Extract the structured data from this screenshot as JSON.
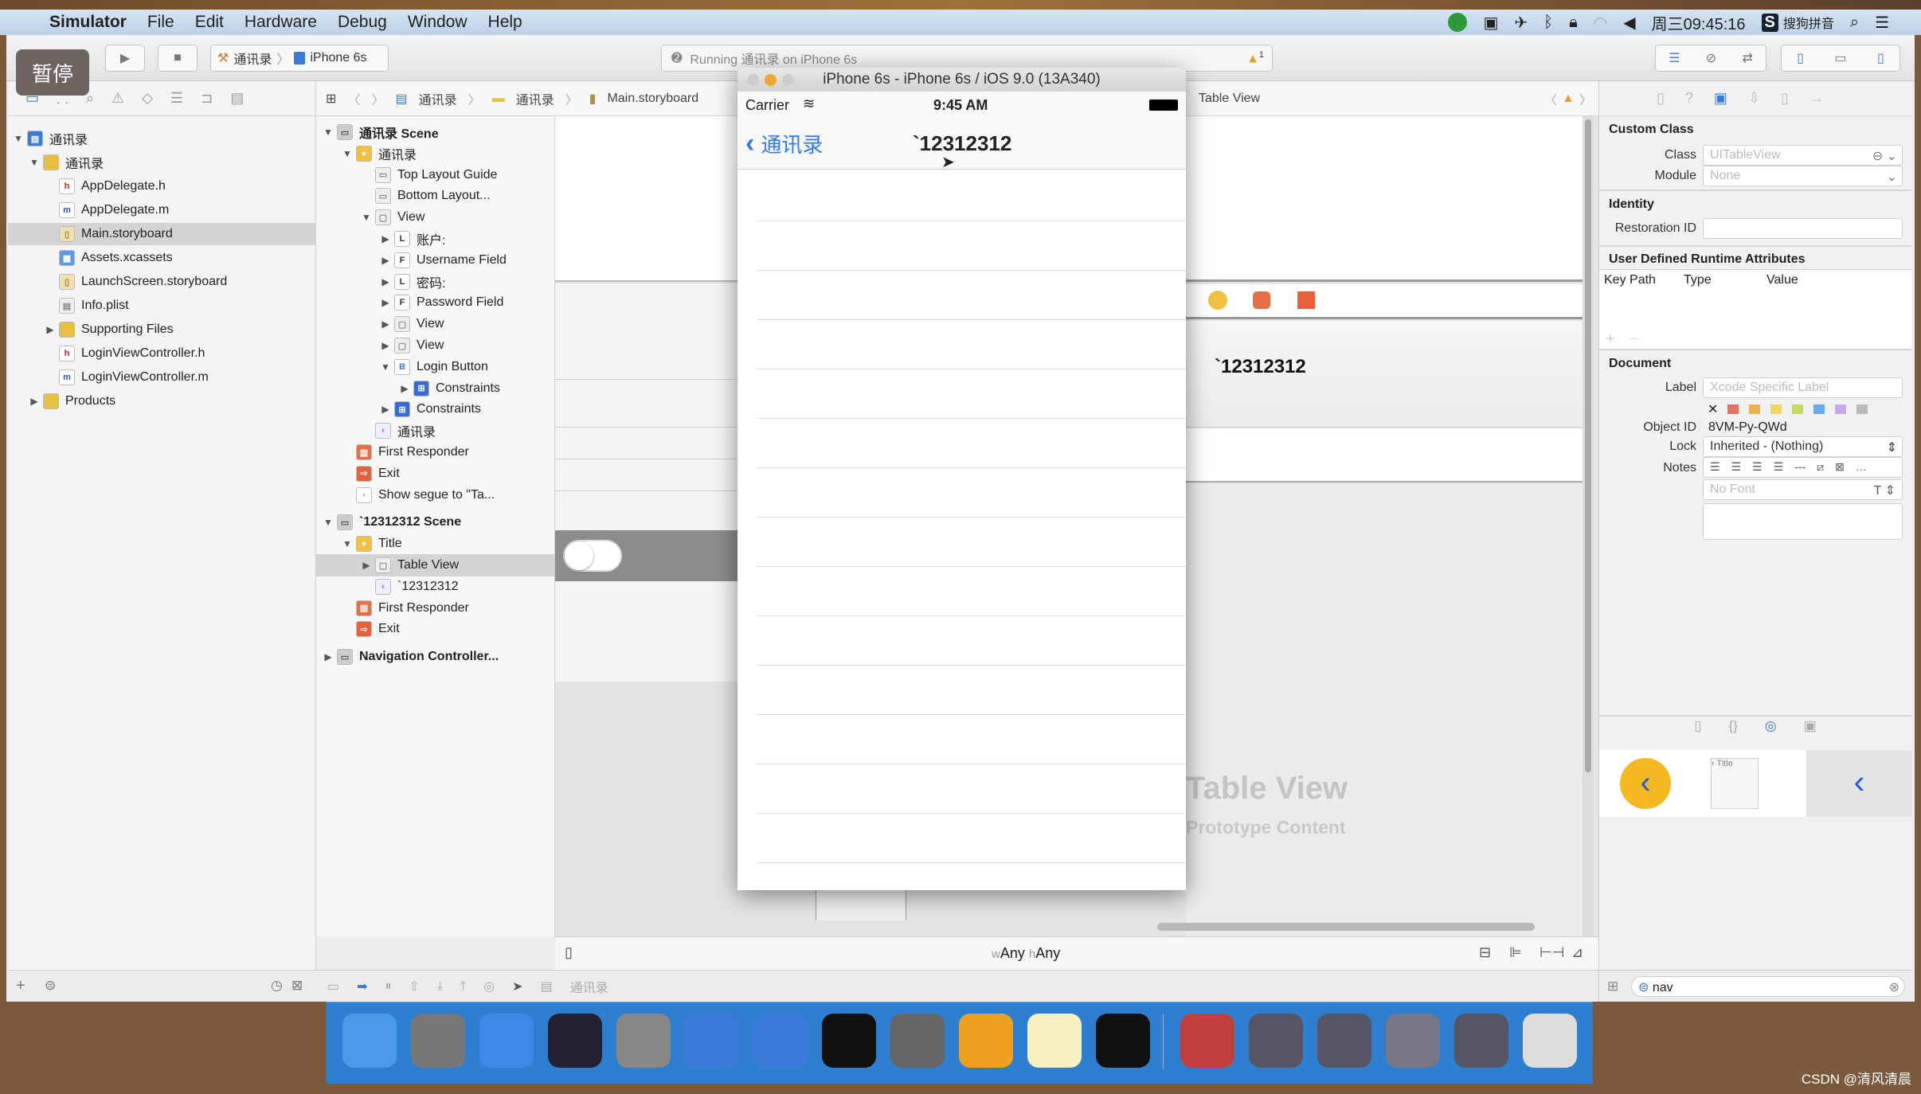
{
  "menubar": {
    "app": "Simulator",
    "items": [
      "File",
      "Edit",
      "Hardware",
      "Debug",
      "Window",
      "Help"
    ],
    "clock": "周三09:45:16",
    "ime": "搜狗拼音"
  },
  "overlay": {
    "pause": "暂停"
  },
  "toolbar": {
    "scheme": "通讯录",
    "device": "iPhone 6s",
    "activity": "Running 通讯录 on iPhone 6s",
    "warnings": "1"
  },
  "jumpbar": {
    "crumbs": [
      "通讯录",
      "通讯录",
      "Main.storyboard"
    ],
    "last": "Table View"
  },
  "navigator": {
    "items": [
      {
        "label": "通讯录",
        "lvl": 0,
        "tri": "▼",
        "icon": "project"
      },
      {
        "label": "通讯录",
        "lvl": 1,
        "tri": "▼",
        "icon": "folder"
      },
      {
        "label": "AppDelegate.h",
        "lvl": 2,
        "icon": "h"
      },
      {
        "label": "AppDelegate.m",
        "lvl": 2,
        "icon": "m"
      },
      {
        "label": "Main.storyboard",
        "lvl": 2,
        "icon": "storyboard",
        "selected": true
      },
      {
        "label": "Assets.xcassets",
        "lvl": 2,
        "icon": "assets"
      },
      {
        "label": "LaunchScreen.storyboard",
        "lvl": 2,
        "icon": "storyboard"
      },
      {
        "label": "Info.plist",
        "lvl": 2,
        "icon": "plist"
      },
      {
        "label": "Supporting Files",
        "lvl": 2,
        "tri": "▶",
        "icon": "folder"
      },
      {
        "label": "LoginViewController.h",
        "lvl": 2,
        "icon": "h"
      },
      {
        "label": "LoginViewController.m",
        "lvl": 2,
        "icon": "m"
      },
      {
        "label": "Products",
        "lvl": 1,
        "tri": "▶",
        "icon": "folder"
      }
    ]
  },
  "outline": {
    "items": [
      {
        "label": "通讯录 Scene",
        "lvl": 0,
        "tri": "▼",
        "icon": "scene",
        "bold": true
      },
      {
        "label": "通讯录",
        "lvl": 1,
        "tri": "▼",
        "icon": "vc"
      },
      {
        "label": "Top Layout Guide",
        "lvl": 2,
        "icon": "guide"
      },
      {
        "label": "Bottom Layout...",
        "lvl": 2,
        "icon": "guide"
      },
      {
        "label": "View",
        "lvl": 2,
        "tri": "▼",
        "icon": "view"
      },
      {
        "label": "账户:",
        "lvl": 3,
        "tri": "▶",
        "icon": "L"
      },
      {
        "label": "Username Field",
        "lvl": 3,
        "tri": "▶",
        "icon": "F"
      },
      {
        "label": "密码:",
        "lvl": 3,
        "tri": "▶",
        "icon": "L"
      },
      {
        "label": "Password Field",
        "lvl": 3,
        "tri": "▶",
        "icon": "F"
      },
      {
        "label": "View",
        "lvl": 3,
        "tri": "▶",
        "icon": "view"
      },
      {
        "label": "View",
        "lvl": 3,
        "tri": "▶",
        "icon": "view"
      },
      {
        "label": "Login Button",
        "lvl": 3,
        "tri": "▼",
        "icon": "B"
      },
      {
        "label": "Constraints",
        "lvl": 4,
        "tri": "▶",
        "icon": "constraints"
      },
      {
        "label": "Constraints",
        "lvl": 3,
        "tri": "▶",
        "icon": "constraints"
      },
      {
        "label": "通讯录",
        "lvl": 2,
        "icon": "navitem"
      },
      {
        "label": "First Responder",
        "lvl": 1,
        "icon": "responder"
      },
      {
        "label": "Exit",
        "lvl": 1,
        "icon": "exit"
      },
      {
        "label": "Show segue to \"Ta...",
        "lvl": 1,
        "icon": "segue"
      },
      {
        "label": "`12312312 Scene",
        "lvl": 0,
        "tri": "▼",
        "icon": "scene",
        "bold": true,
        "gap": true
      },
      {
        "label": "Title",
        "lvl": 1,
        "tri": "▼",
        "icon": "vc"
      },
      {
        "label": "Table View",
        "lvl": 2,
        "tri": "▶",
        "icon": "view",
        "selected": true
      },
      {
        "label": "`12312312",
        "lvl": 2,
        "icon": "navitem"
      },
      {
        "label": "First Responder",
        "lvl": 1,
        "icon": "responder"
      },
      {
        "label": "Exit",
        "lvl": 1,
        "icon": "exit"
      },
      {
        "label": "Navigation Controller...",
        "lvl": 0,
        "tri": "▶",
        "icon": "scene",
        "bold": true,
        "gap": true
      }
    ]
  },
  "simulator": {
    "title": "iPhone 6s - iPhone 6s / iOS 9.0 (13A340)",
    "carrier": "Carrier",
    "time": "9:45 AM",
    "back": "通讯录",
    "navtitle": "`12312312"
  },
  "canvas": {
    "navtitle": "`12312312",
    "placeholder_title": "Table View",
    "placeholder_sub": "Prototype Content",
    "size_w": "w",
    "size_any1": "Any",
    "size_h": "h",
    "size_any2": "Any"
  },
  "inspector": {
    "custom_class": {
      "title": "Custom Class",
      "class_label": "Class",
      "class_value": "UITableView",
      "module_label": "Module",
      "module_value": "None"
    },
    "identity": {
      "title": "Identity",
      "restoration_label": "Restoration ID",
      "restoration_value": ""
    },
    "udra": {
      "title": "User Defined Runtime Attributes",
      "cols": [
        "Key Path",
        "Type",
        "Value"
      ]
    },
    "document": {
      "title": "Document",
      "label_label": "Label",
      "label_placeholder": "Xcode Specific Label",
      "object_id_label": "Object ID",
      "object_id": "8VM-Py-QWd",
      "lock_label": "Lock",
      "lock_value": "Inherited - (Nothing)",
      "notes_label": "Notes",
      "font_placeholder": "No Font"
    },
    "label_colors": [
      "#e87060",
      "#f0b050",
      "#f0d860",
      "#c8d860",
      "#6aaaf0",
      "#c8a8e8",
      "#bbbbbb"
    ],
    "library": {
      "title_item": "Title"
    },
    "filter": "nav"
  },
  "debug": {
    "target": "通讯录"
  },
  "dock": {
    "apps": [
      "finder",
      "launchpad",
      "safari",
      "mouse",
      "photo-booth",
      "xcode",
      "instruments",
      "terminal",
      "system-preferences",
      "sketch",
      "notes",
      "console",
      "media-player",
      "screen1",
      "screen2",
      "screen3",
      "screen4",
      "trash"
    ]
  },
  "watermark": "CSDN @清风清晨",
  "colors": {
    "accent": "#2f7bf5",
    "dock": "#2f7fd0",
    "warning": "#f0a020"
  }
}
